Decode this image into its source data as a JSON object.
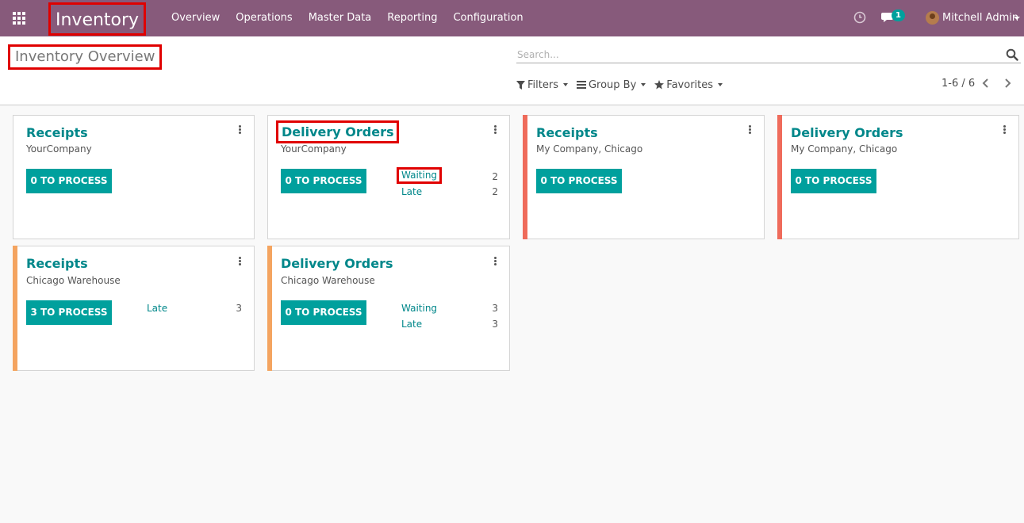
{
  "navbar": {
    "app_title": "Inventory",
    "menu": [
      "Overview",
      "Operations",
      "Master Data",
      "Reporting",
      "Configuration"
    ],
    "chat_badge": "1",
    "user_name": "Mitchell Admin",
    "icons": [
      "apps-grid-icon",
      "clock-icon",
      "chat-icon",
      "avatar"
    ]
  },
  "control_panel": {
    "page_title": "Inventory Overview",
    "search_placeholder": "Search...",
    "filters": "Filters",
    "group_by": "Group By",
    "favorites": "Favorites",
    "pager": "1-6 / 6"
  },
  "colors": {
    "navbar": "#875a7b",
    "accent": "#00a09d",
    "title_text": "#00878a",
    "bar_red": "#ef6b5b",
    "bar_orange": "#f4a460",
    "highlight": "#e00000"
  },
  "cards": [
    {
      "title": "Receipts",
      "company": "YourCompany",
      "button": "0 TO PROCESS",
      "stats": []
    },
    {
      "title": "Delivery Orders",
      "company": "YourCompany",
      "button": "0 TO PROCESS",
      "stats": [
        {
          "label": "Waiting",
          "count": "2"
        },
        {
          "label": "Late",
          "count": "2"
        }
      ]
    },
    {
      "title": "Receipts",
      "company": "My Company, Chicago",
      "button": "0 TO PROCESS",
      "stats": []
    },
    {
      "title": "Delivery Orders",
      "company": "My Company, Chicago",
      "button": "0 TO PROCESS",
      "stats": []
    },
    {
      "title": "Receipts",
      "company": "Chicago Warehouse",
      "button": "3 TO PROCESS",
      "stats": [
        {
          "label": "Late",
          "count": "3"
        }
      ]
    },
    {
      "title": "Delivery Orders",
      "company": "Chicago Warehouse",
      "button": "0 TO PROCESS",
      "stats": [
        {
          "label": "Waiting",
          "count": "3"
        },
        {
          "label": "Late",
          "count": "3"
        }
      ]
    }
  ]
}
